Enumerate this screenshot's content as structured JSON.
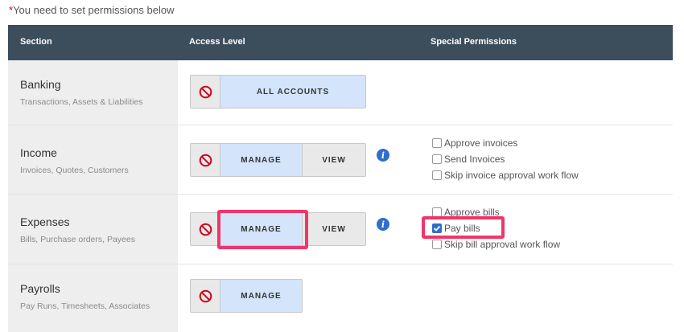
{
  "notice": {
    "asterisk": "*",
    "text": "You need to set permissions below"
  },
  "header": {
    "section": "Section",
    "access_level": "Access Level",
    "special_permissions": "Special Permissions"
  },
  "rows": [
    {
      "title": "Banking",
      "subtitle": "Transactions, Assets & Liabilities",
      "options": [
        {
          "label": "ALL ACCOUNTS",
          "active": true
        }
      ],
      "permissions": []
    },
    {
      "title": "Income",
      "subtitle": "Invoices, Quotes, Customers",
      "options": [
        {
          "label": "MANAGE",
          "active": true
        },
        {
          "label": "VIEW",
          "active": false
        }
      ],
      "permissions": [
        {
          "label": "Approve invoices",
          "checked": false
        },
        {
          "label": "Send Invoices",
          "checked": false
        },
        {
          "label": "Skip invoice approval work flow",
          "checked": false
        }
      ]
    },
    {
      "title": "Expenses",
      "subtitle": "Bills, Purchase orders, Payees",
      "options": [
        {
          "label": "MANAGE",
          "active": true
        },
        {
          "label": "VIEW",
          "active": false
        }
      ],
      "permissions": [
        {
          "label": "Approve bills",
          "checked": false
        },
        {
          "label": "Pay bills",
          "checked": true
        },
        {
          "label": "Skip bill approval work flow",
          "checked": false
        }
      ]
    },
    {
      "title": "Payrolls",
      "subtitle": "Pay Runs, Timesheets, Associates",
      "options": [
        {
          "label": "MANAGE",
          "active": true
        }
      ],
      "permissions": []
    }
  ],
  "icons": {
    "ban": "ban-icon",
    "info": "info-icon",
    "check": "checkmark-icon"
  },
  "colors": {
    "header_bg": "#3c4d5c",
    "active_option": "#d3e4fb",
    "highlight": "#f0356b",
    "info": "#2f6fca",
    "ban": "#d0021b"
  }
}
